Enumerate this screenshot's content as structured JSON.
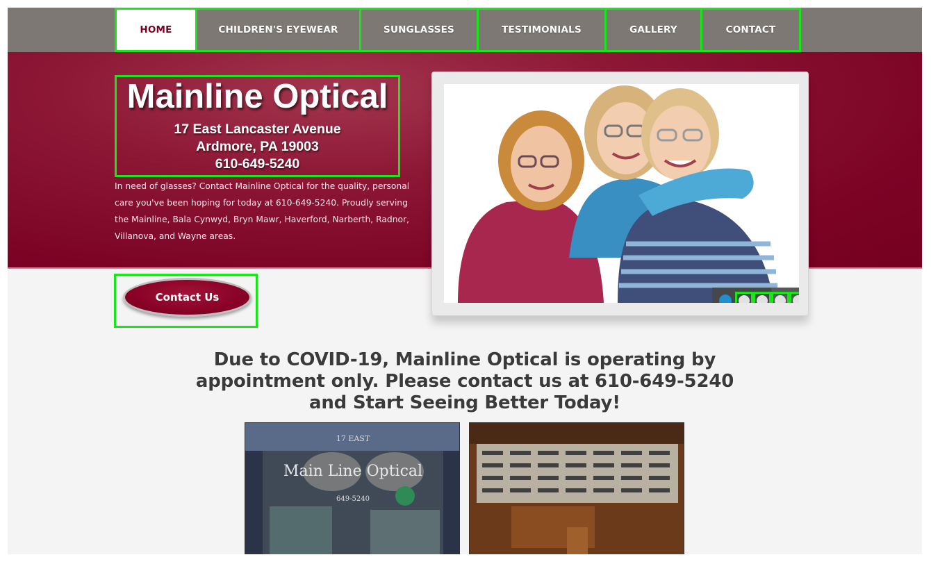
{
  "nav": {
    "items": [
      {
        "label": "HOME",
        "active": true
      },
      {
        "label": "CHILDREN'S EYEWEAR",
        "active": false
      },
      {
        "label": "SUNGLASSES",
        "active": false
      },
      {
        "label": "TESTIMONIALS",
        "active": false
      },
      {
        "label": "GALLERY",
        "active": false
      },
      {
        "label": "CONTACT",
        "active": false
      }
    ]
  },
  "logo": {
    "title": "Mainline Optical",
    "address1": "17 East Lancaster Avenue",
    "address2": "Ardmore, PA 19003",
    "phone": "610-649-5240"
  },
  "intro": {
    "text": "In need of glasses? Contact Mainline Optical for the quality, personal care you've been hoping for today at 610-649-5240. Proudly serving the Mainline, Bala Cynwyd, Bryn Mawr, Haverford, Narberth, Radnor, Villanova, and Wayne areas."
  },
  "contact_button": {
    "label": "Contact Us"
  },
  "slider": {
    "slide_count": 5,
    "active_index": 0
  },
  "covid": {
    "line1": "Due to COVID-19, Mainline Optical is operating by",
    "line2": "appointment only. Please contact us at 610-649-5240",
    "line3": "and Start Seeing Better Today!"
  },
  "storefront_sign": {
    "top": "17 EAST",
    "name": "Main Line Optical",
    "phone": "649-5240"
  },
  "colors": {
    "brand_maroon": "#7c0324",
    "nav_gray": "#7d7874",
    "highlight_green": "#19e619",
    "active_dot_blue": "#1f8fd0"
  }
}
